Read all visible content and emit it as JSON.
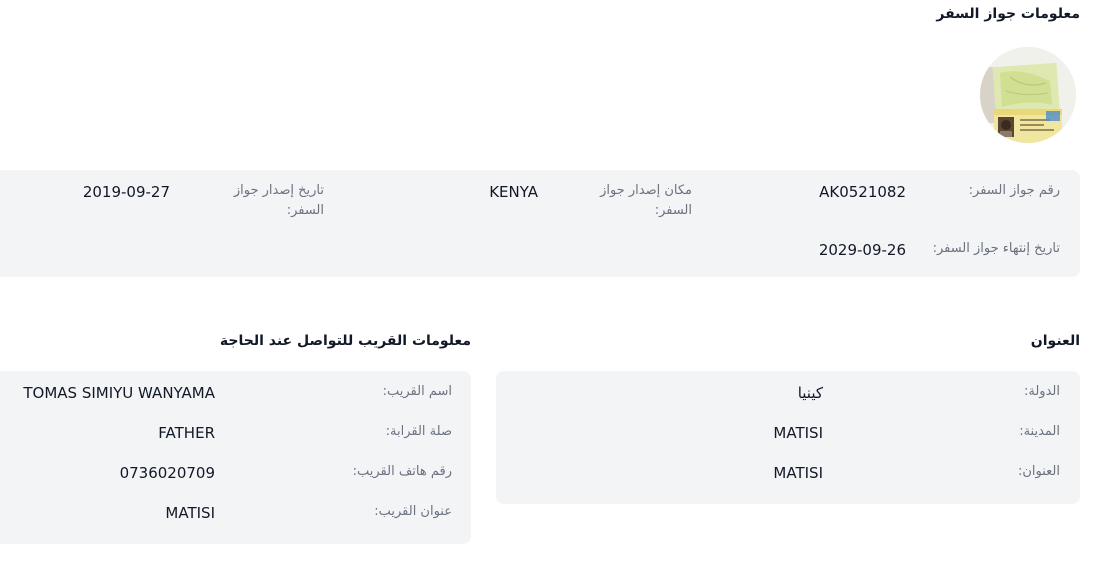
{
  "passport": {
    "title": "معلومات جواز السفر",
    "number_label": "رقم جواز السفر:",
    "number_value": "AK0521082",
    "place_label": "مكان إصدار جواز السفر:",
    "place_value": "KENYA",
    "issue_date_label": "تاريخ إصدار جواز السفر:",
    "issue_date_value": "2019-09-27",
    "expiry_label": "تاريخ إنتهاء جواز السفر:",
    "expiry_value": "2029-09-26"
  },
  "address": {
    "title": "العنوان",
    "country_label": "الدولة:",
    "country_value": "كينيا",
    "city_label": "المدينة:",
    "city_value": "MATISI",
    "address_label": "العنوان:",
    "address_value": "MATISI"
  },
  "relative": {
    "title": "معلومات القريب للتواصل عند الحاجة",
    "name_label": "اسم القريب:",
    "name_value": "TOMAS SIMIYU WANYAMA",
    "relation_label": "صلة القرابة:",
    "relation_value": "FATHER",
    "phone_label": "رقم هاتف القريب:",
    "phone_value": "0736020709",
    "address_label": "عنوان القريب:",
    "address_value": "MATISI"
  }
}
